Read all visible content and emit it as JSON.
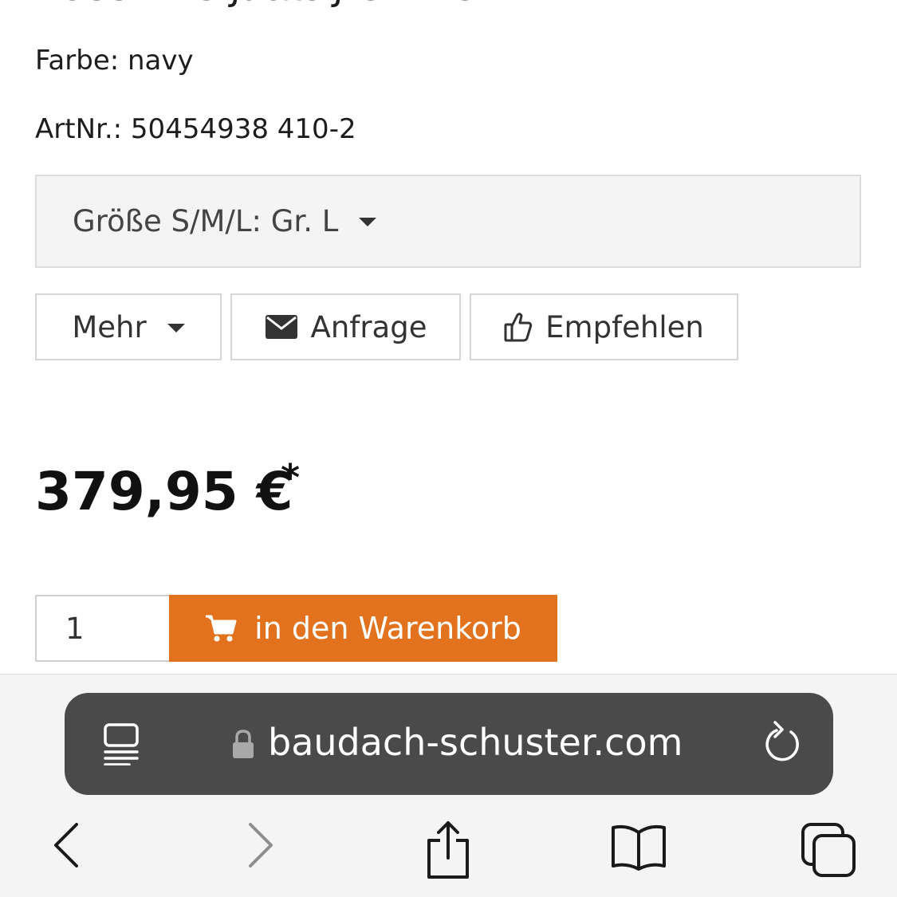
{
  "product": {
    "title": "BOSS HBG Jacke J-GRIP Gr. L",
    "color_line": "Farbe: navy",
    "artnr_line": "ArtNr.: 50454938 410-2"
  },
  "size_select": {
    "label": "Größe S/M/L: Gr. L"
  },
  "actions": {
    "more_label": "Mehr",
    "inquiry_label": "Anfrage",
    "recommend_label": "Empfehlen"
  },
  "price": {
    "value": "379,95 €",
    "footnote_marker": "*"
  },
  "cart": {
    "quantity": "1",
    "add_label": "in den Warenkorb",
    "accent_color": "#e2721e"
  },
  "browser": {
    "url": "baudach-schuster.com",
    "icons": [
      "reader-icon",
      "lock-icon",
      "reload-icon",
      "back-icon",
      "forward-icon",
      "share-icon",
      "bookmarks-icon",
      "tabs-icon"
    ]
  }
}
